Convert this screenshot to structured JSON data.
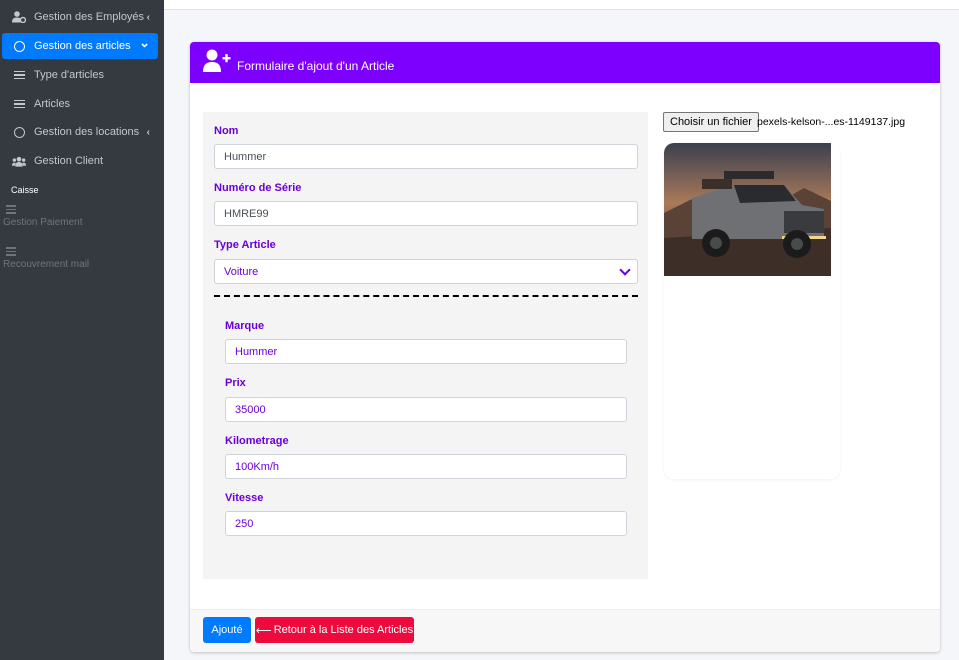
{
  "sidebar": {
    "items": [
      {
        "label": "Gestion des Employés",
        "icon": "user-cog-icon",
        "caret": "‹"
      },
      {
        "label": "Gestion des articles",
        "icon": "circle-icon",
        "caret": "⌄"
      },
      {
        "label": "Type d'articles",
        "icon": "list-icon"
      },
      {
        "label": "Articles",
        "icon": "list-icon"
      },
      {
        "label": "Gestion des locations",
        "icon": "circle-icon",
        "caret": "‹"
      },
      {
        "label": "Gestion Client",
        "icon": "users-icon"
      }
    ],
    "section": "Caisse",
    "faded_items": [
      {
        "label": "Gestion Paiement",
        "icon": "sliders-icon"
      },
      {
        "label": "Recouvrement mail",
        "icon": "sliders-icon"
      }
    ]
  },
  "card": {
    "title": "Formulaire d'ajout d'un Article",
    "header_icon": "user-plus-icon",
    "header_color": "#7d00ff"
  },
  "form": {
    "nom": {
      "label": "Nom",
      "value": "Hummer"
    },
    "serie": {
      "label": "Numéro de Série",
      "value": "HMRE99"
    },
    "type": {
      "label": "Type Article",
      "value": "Voiture"
    },
    "marque": {
      "label": "Marque",
      "value": "Hummer"
    },
    "prix": {
      "label": "Prix",
      "value": "35000"
    },
    "km": {
      "label": "Kilometrage",
      "value": "100Km/h"
    },
    "vitesse": {
      "label": "Vitesse",
      "value": "250"
    }
  },
  "file": {
    "button": "Choisir un fichier",
    "name": "pexels-kelson-...es-1149137.jpg"
  },
  "buttons": {
    "submit": "Ajouté",
    "back": "Retour à la Liste des Articles",
    "back_icon": "arrow-left-icon"
  },
  "colors": {
    "accent": "#7d00ff",
    "primary": "#007bff",
    "danger": "#ec0b3c",
    "sidebar": "#343a40"
  }
}
